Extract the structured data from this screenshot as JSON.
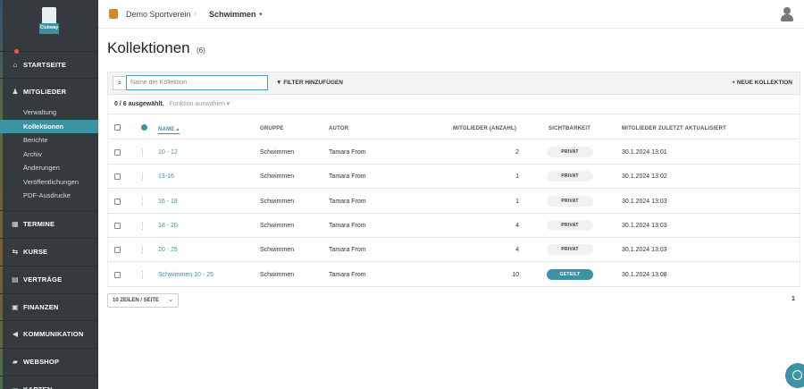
{
  "sidebar": {
    "brand": "Clubway",
    "sections": [
      {
        "label": "STARTSEITE",
        "icon": "home-icon",
        "glyph": "⌂"
      },
      {
        "label": "MITGLIEDER",
        "icon": "user-icon",
        "glyph": "♟"
      },
      {
        "label": "TERMINE",
        "icon": "calendar-icon",
        "glyph": "▦"
      },
      {
        "label": "KURSE",
        "icon": "course-icon",
        "glyph": "⇆"
      },
      {
        "label": "VERTRÄGE",
        "icon": "contract-icon",
        "glyph": "▤"
      },
      {
        "label": "FINANZEN",
        "icon": "finance-icon",
        "glyph": "▣"
      },
      {
        "label": "KOMMUNIKATION",
        "icon": "megaphone-icon",
        "glyph": "◀"
      },
      {
        "label": "WEBSHOP",
        "icon": "cart-icon",
        "glyph": "▰"
      },
      {
        "label": "KARTEN",
        "icon": "card-icon",
        "glyph": "▭"
      }
    ],
    "members_sub": [
      {
        "label": "Verwaltung",
        "active": false
      },
      {
        "label": "Kollektionen",
        "active": true
      },
      {
        "label": "Berichte",
        "active": false
      },
      {
        "label": "Archiv",
        "active": false
      },
      {
        "label": "Änderungen",
        "active": false
      },
      {
        "label": "Veröffentlichungen",
        "active": false
      },
      {
        "label": "PDF-Ausdrucke",
        "active": false
      }
    ]
  },
  "topbar": {
    "club": "Demo Sportverein",
    "separator": "›",
    "section": "Schwimmen",
    "caret": "▾"
  },
  "page": {
    "title": "Kollektionen",
    "count": "(6)"
  },
  "toolbar": {
    "search_icon": "⌕",
    "search_placeholder": "Name der Kollektion",
    "filter_label": "FILTER HINZUFÜGEN",
    "new_label": "NEUE KOLLEKTION"
  },
  "selection": {
    "count": "0 / 6 ausgewählt.",
    "function": "Funktion auswählen ▾"
  },
  "table": {
    "headers": {
      "name": "NAME ▴",
      "group": "GRUPPE",
      "author": "AUTOR",
      "members": "MITGLIEDER (ANZAHL)",
      "visibility": "SICHTBARKEIT",
      "updated": "MITGLIEDER ZULETZT AKTUALISIERT"
    },
    "rows": [
      {
        "name": "10 - 12",
        "group": "Schwimmen",
        "author": "Tamara From",
        "members": "2",
        "visibility": "PRIVAT",
        "updated": "30.1.2024 13:01"
      },
      {
        "name": "13-16",
        "group": "Schwimmen",
        "author": "Tamara From",
        "members": "1",
        "visibility": "PRIVAT",
        "updated": "30.1.2024 13:02"
      },
      {
        "name": "16 - 18",
        "group": "Schwimmen",
        "author": "Tamara From",
        "members": "1",
        "visibility": "PRIVAT",
        "updated": "30.1.2024 13:03"
      },
      {
        "name": "18 - 20",
        "group": "Schwimmen",
        "author": "Tamara From",
        "members": "4",
        "visibility": "PRIVAT",
        "updated": "30.1.2024 13:03"
      },
      {
        "name": "20 - 25",
        "group": "Schwimmen",
        "author": "Tamara From",
        "members": "4",
        "visibility": "PRIVAT",
        "updated": "30.1.2024 13:03"
      },
      {
        "name": "Schwimmen 10 - 25",
        "group": "Schwimmen",
        "author": "Tamara From",
        "members": "10",
        "visibility": "GETEILT",
        "updated": "30.1.2024 13:08"
      }
    ]
  },
  "pagination": {
    "rows_per_page": "10 ZEILEN / SEITE",
    "current_page": "1"
  }
}
